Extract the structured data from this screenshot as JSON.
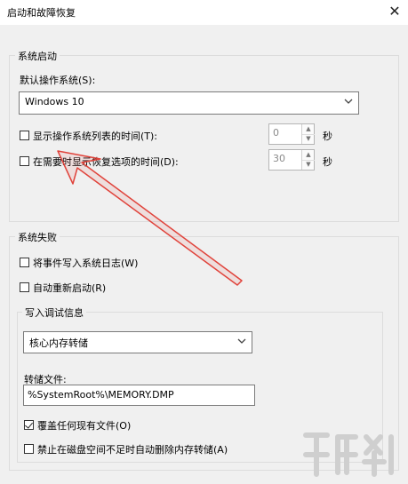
{
  "window": {
    "title": "启动和故障恢复",
    "close_glyph": "✕"
  },
  "system_startup": {
    "group_label": "系统启动",
    "default_os_label": "默认操作系统(S):",
    "default_os_value": "Windows 10",
    "show_os_list": {
      "label": "显示操作系统列表的时间(T):",
      "checked": false,
      "value": "0",
      "unit": "秒"
    },
    "show_recovery": {
      "label": "在需要时显示恢复选项的时间(D):",
      "checked": false,
      "value": "30",
      "unit": "秒"
    }
  },
  "system_failure": {
    "group_label": "系统失败",
    "write_event_log": {
      "label": "将事件写入系统日志(W)",
      "checked": false
    },
    "auto_restart": {
      "label": "自动重新启动(R)",
      "checked": false
    },
    "debug_info": {
      "group_label": "写入调试信息",
      "dump_type_value": "核心内存转储",
      "dump_file_label": "转储文件:",
      "dump_file_value": "%SystemRoot%\\MEMORY.DMP",
      "overwrite": {
        "label": "覆盖任何现有文件(O)",
        "checked": true
      },
      "disable_auto_delete": {
        "label": "禁止在磁盘空间不足时自动删除内存转储(A)",
        "checked": false
      }
    }
  },
  "colors": {
    "annotation_arrow": "#e0433b",
    "window_bg": "#f0f0f0"
  },
  "icons": {
    "close": "close-icon",
    "dropdown": "chevron-down-icon",
    "spin_up": "spin-up-icon",
    "spin_down": "spin-down-icon"
  }
}
